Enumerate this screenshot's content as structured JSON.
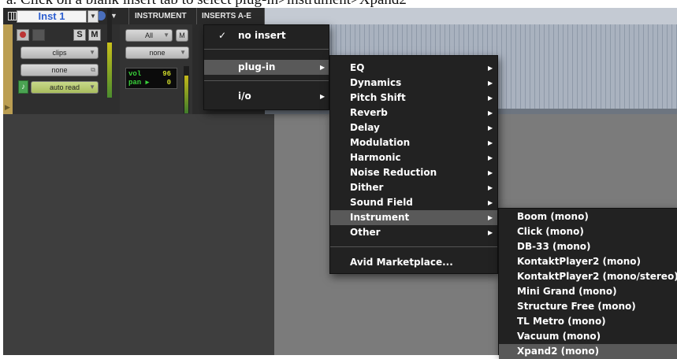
{
  "caption": "a.  Click on a blank insert tab to select plug-in>instrument>Xpand2",
  "header": {
    "instrument_tab": "INSTRUMENT",
    "inserts_tab": "INSERTS A-E"
  },
  "track": {
    "name": "Inst 1",
    "solo_label": "S",
    "mute_label": "M",
    "clips_label": "clips",
    "output_label": "none",
    "automation_label": "auto read"
  },
  "instrument": {
    "channel_select": "All",
    "mute_label": "M",
    "input_label": "none",
    "vol_label": "vol",
    "vol_value": "96",
    "pan_label": "pan",
    "pan_value": "0"
  },
  "insert_menu": {
    "checked": "✓",
    "items": [
      "no insert",
      "plug-in",
      "i/o"
    ]
  },
  "plugin_menu": {
    "categories": [
      "EQ",
      "Dynamics",
      "Pitch Shift",
      "Reverb",
      "Delay",
      "Modulation",
      "Harmonic",
      "Noise Reduction",
      "Dither",
      "Sound Field",
      "Instrument",
      "Other"
    ],
    "marketplace": "Avid Marketplace..."
  },
  "instrument_submenu": {
    "items": [
      "Boom (mono)",
      "Click (mono)",
      "DB-33 (mono)",
      "KontaktPlayer2 (mono)",
      "KontaktPlayer2 (mono/stereo)",
      "Mini Grand (mono)",
      "Structure Free (mono)",
      "TL Metro (mono)",
      "Vacuum (mono)",
      "Xpand2 (mono)"
    ]
  },
  "icons": {
    "submenu_arrow": "▶",
    "dropdown_caret": "▼",
    "clock": "clock-icon",
    "midi": "midi-note-icon"
  }
}
